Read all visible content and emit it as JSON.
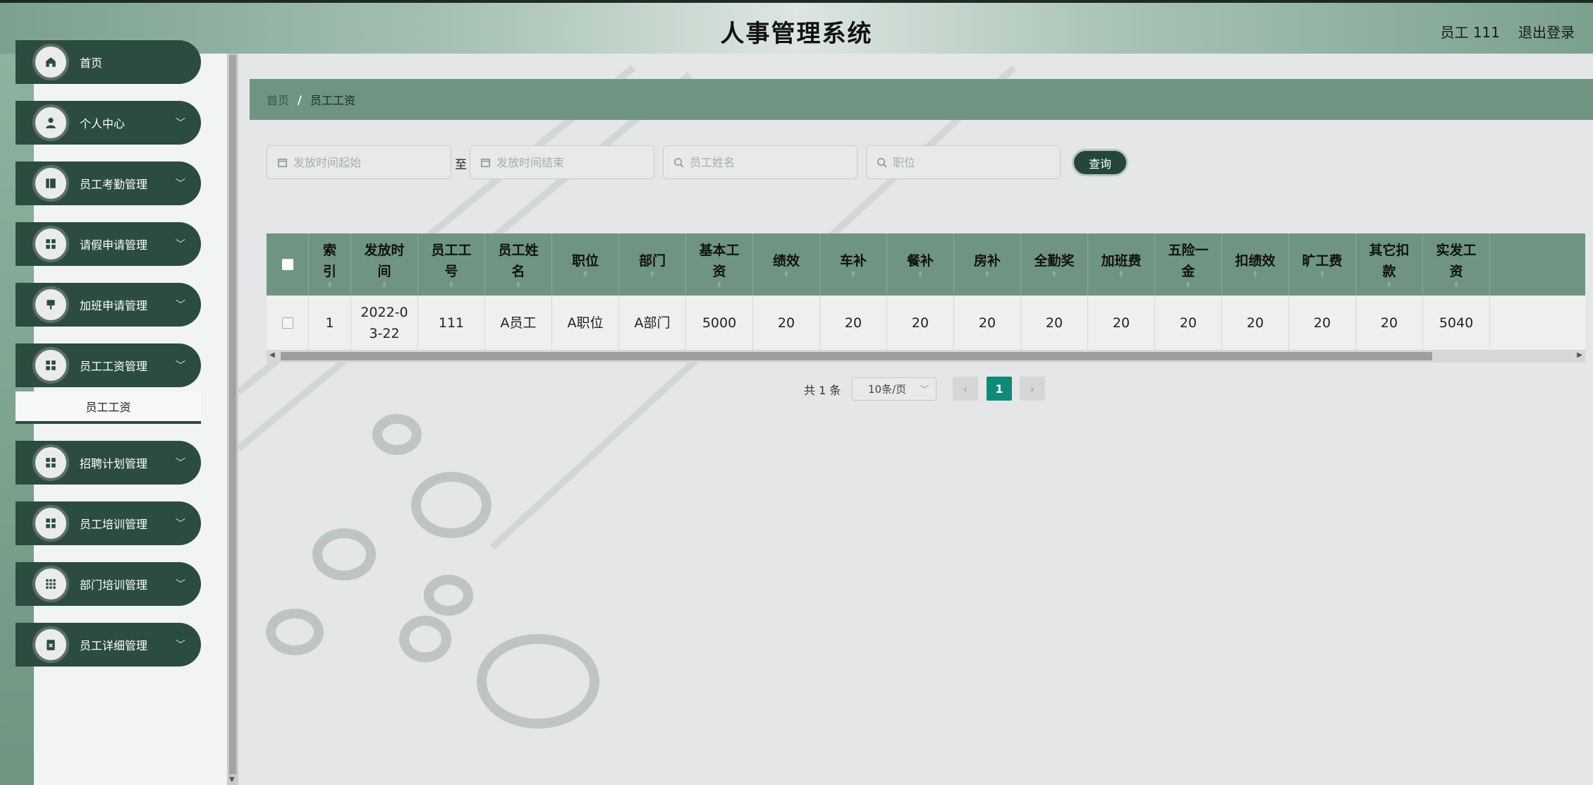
{
  "header": {
    "title": "人事管理系统",
    "user": "员工 111",
    "logout": "退出登录"
  },
  "sidebar": {
    "items": [
      {
        "label": "首页",
        "icon": "home-icon"
      },
      {
        "label": "个人中心",
        "icon": "user-icon"
      },
      {
        "label": "员工考勤管理",
        "icon": "book-icon"
      },
      {
        "label": "请假申请管理",
        "icon": "grid-icon"
      },
      {
        "label": "加班申请管理",
        "icon": "pin-icon"
      },
      {
        "label": "员工工资管理",
        "icon": "grid-icon"
      },
      {
        "label": "招聘计划管理",
        "icon": "grid-icon"
      },
      {
        "label": "员工培训管理",
        "icon": "grid-icon"
      },
      {
        "label": "部门培训管理",
        "icon": "apps-icon"
      },
      {
        "label": "员工详细管理",
        "icon": "clipboard-icon"
      }
    ],
    "submenu_label": "员工工资"
  },
  "breadcrumb": {
    "home": "首页",
    "separator": "/",
    "current": "员工工资"
  },
  "search": {
    "start_placeholder": "发放时间起始",
    "to_label": "至",
    "end_placeholder": "发放时间结束",
    "name_placeholder": "员工姓名",
    "position_placeholder": "职位",
    "query_label": "查询"
  },
  "table": {
    "headers": [
      {
        "l1": "索",
        "l2": "引"
      },
      {
        "l1": "发放时",
        "l2": "间"
      },
      {
        "l1": "员工工",
        "l2": "号"
      },
      {
        "l1": "员工姓",
        "l2": "名"
      },
      {
        "l1": "职位",
        "l2": ""
      },
      {
        "l1": "部门",
        "l2": ""
      },
      {
        "l1": "基本工",
        "l2": "资"
      },
      {
        "l1": "绩效",
        "l2": ""
      },
      {
        "l1": "车补",
        "l2": ""
      },
      {
        "l1": "餐补",
        "l2": ""
      },
      {
        "l1": "房补",
        "l2": ""
      },
      {
        "l1": "全勤奖",
        "l2": ""
      },
      {
        "l1": "加班费",
        "l2": ""
      },
      {
        "l1": "五险一",
        "l2": "金"
      },
      {
        "l1": "扣绩效",
        "l2": ""
      },
      {
        "l1": "旷工费",
        "l2": ""
      },
      {
        "l1": "其它扣",
        "l2": "款"
      },
      {
        "l1": "实发工",
        "l2": "资"
      }
    ],
    "rows": [
      [
        "1",
        "2022-0\n3-22",
        "111",
        "A员工",
        "A职位",
        "A部门",
        "5000",
        "20",
        "20",
        "20",
        "20",
        "20",
        "20",
        "20",
        "20",
        "20",
        "20",
        "5040"
      ]
    ]
  },
  "pagination": {
    "total": "共 1 条",
    "page_size": "10条/页",
    "current_page": "1"
  },
  "colors": {
    "accent": "#2b4c3e",
    "table_header": "#6f9582",
    "active_page": "#0f8a76"
  }
}
